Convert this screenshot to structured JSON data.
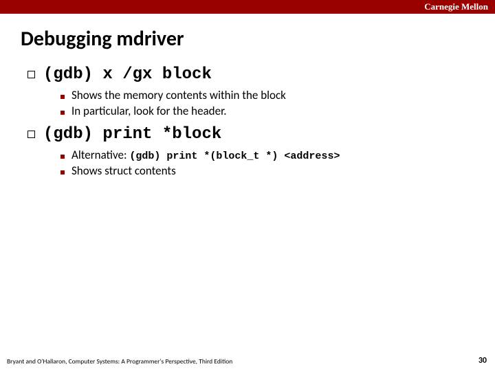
{
  "brand": "Carnegie Mellon",
  "title": "Debugging mdriver",
  "items": [
    {
      "cmd": "(gdb) x /gx block",
      "subs": [
        {
          "text": "Shows the memory contents within the block"
        },
        {
          "text": "In particular, look for the header."
        }
      ]
    },
    {
      "cmd": "(gdb) print *block",
      "subs": [
        {
          "prefix": "Alternative: ",
          "code": "(gdb) print *(block_t *) <address>"
        },
        {
          "text": "Shows struct contents"
        }
      ]
    }
  ],
  "footer": "Bryant and O'Hallaron, Computer Systems: A Programmer's Perspective, Third Edition",
  "page": "30"
}
